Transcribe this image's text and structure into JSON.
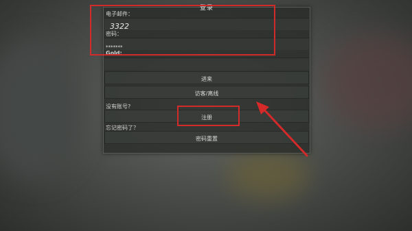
{
  "dialog": {
    "title": "登录",
    "email_label": "电子邮件：",
    "email_value": "3322",
    "password_label": "密码：",
    "password_value": "*******",
    "gold_label": "Gold:",
    "gold_value": "",
    "enter_button": "进来",
    "guest_button": "访客/离线",
    "no_account_label": "没有账号?",
    "register_button": "注册",
    "forgot_label": "忘记密码了？",
    "reset_button": "密码重置"
  },
  "colors": {
    "highlight": "#d42a2a",
    "panel_bg": "#2a2c2a",
    "text": "#d8d8d8"
  }
}
